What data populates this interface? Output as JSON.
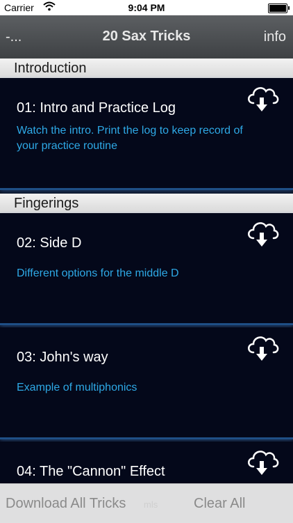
{
  "status": {
    "carrier": "Carrier",
    "time": "9:04 PM"
  },
  "nav": {
    "back": "-...",
    "title": "20 Sax Tricks",
    "info": "info"
  },
  "sections": [
    {
      "header": "Introduction",
      "items": [
        {
          "title": "01: Intro and Practice Log",
          "desc": "Watch the intro. Print the log to keep record of your practice routine",
          "icon": "cloud-download-icon"
        }
      ]
    },
    {
      "header": "Fingerings",
      "items": [
        {
          "title": "02: Side D",
          "desc": "Different options for the middle D",
          "icon": "cloud-download-icon"
        },
        {
          "title": "03: John's way",
          "desc": "Example of multiphonics",
          "icon": "cloud-download-icon"
        },
        {
          "title": "04: The \"Cannon\" Effect",
          "desc": "",
          "icon": "cloud-download-icon"
        }
      ]
    }
  ],
  "toolbar": {
    "download_all": "Download All Tricks",
    "ghost_label": "mls",
    "clear_all": "Clear All"
  },
  "colors": {
    "accent_desc": "#2ea9e6",
    "cell_bg": "#04081a",
    "separator": "#1f4f86"
  }
}
